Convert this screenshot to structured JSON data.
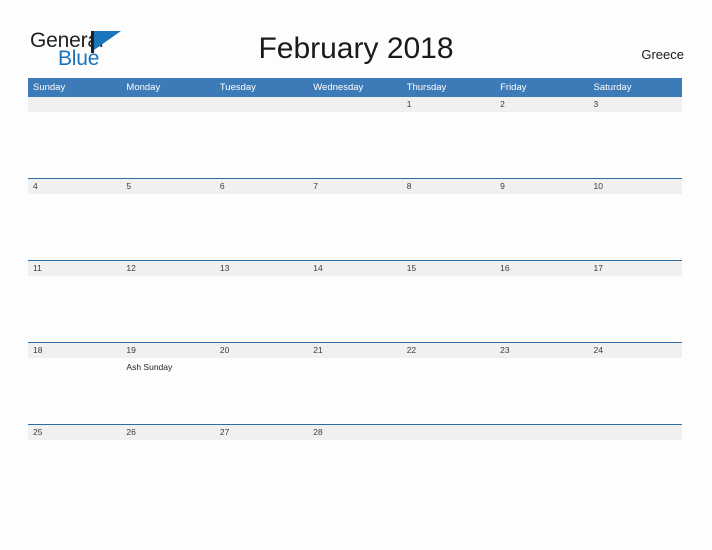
{
  "brand": {
    "name_part1": "General",
    "name_part2": "Blue",
    "flag_icon": "flag-triangle-icon",
    "colors": {
      "dark": "#231f20",
      "blue": "#1b75bb"
    }
  },
  "header": {
    "title": "February 2018",
    "region": "Greece"
  },
  "calendar": {
    "accent_header_color": "#3d7ab8",
    "date_band_color": "#f0f0f0",
    "row_line_color": "#2e6da4",
    "day_headers": [
      "Sunday",
      "Monday",
      "Tuesday",
      "Wednesday",
      "Thursday",
      "Friday",
      "Saturday"
    ],
    "weeks": [
      {
        "days": [
          {
            "date": "",
            "events": []
          },
          {
            "date": "",
            "events": []
          },
          {
            "date": "",
            "events": []
          },
          {
            "date": "",
            "events": []
          },
          {
            "date": "1",
            "events": []
          },
          {
            "date": "2",
            "events": []
          },
          {
            "date": "3",
            "events": []
          }
        ]
      },
      {
        "days": [
          {
            "date": "4",
            "events": []
          },
          {
            "date": "5",
            "events": []
          },
          {
            "date": "6",
            "events": []
          },
          {
            "date": "7",
            "events": []
          },
          {
            "date": "8",
            "events": []
          },
          {
            "date": "9",
            "events": []
          },
          {
            "date": "10",
            "events": []
          }
        ]
      },
      {
        "days": [
          {
            "date": "11",
            "events": []
          },
          {
            "date": "12",
            "events": []
          },
          {
            "date": "13",
            "events": []
          },
          {
            "date": "14",
            "events": []
          },
          {
            "date": "15",
            "events": []
          },
          {
            "date": "16",
            "events": []
          },
          {
            "date": "17",
            "events": []
          }
        ]
      },
      {
        "days": [
          {
            "date": "18",
            "events": []
          },
          {
            "date": "19",
            "events": [
              "Ash Sunday"
            ]
          },
          {
            "date": "20",
            "events": []
          },
          {
            "date": "21",
            "events": []
          },
          {
            "date": "22",
            "events": []
          },
          {
            "date": "23",
            "events": []
          },
          {
            "date": "24",
            "events": []
          }
        ]
      },
      {
        "days": [
          {
            "date": "25",
            "events": []
          },
          {
            "date": "26",
            "events": []
          },
          {
            "date": "27",
            "events": []
          },
          {
            "date": "28",
            "events": []
          },
          {
            "date": "",
            "events": []
          },
          {
            "date": "",
            "events": []
          },
          {
            "date": "",
            "events": []
          }
        ]
      }
    ]
  }
}
